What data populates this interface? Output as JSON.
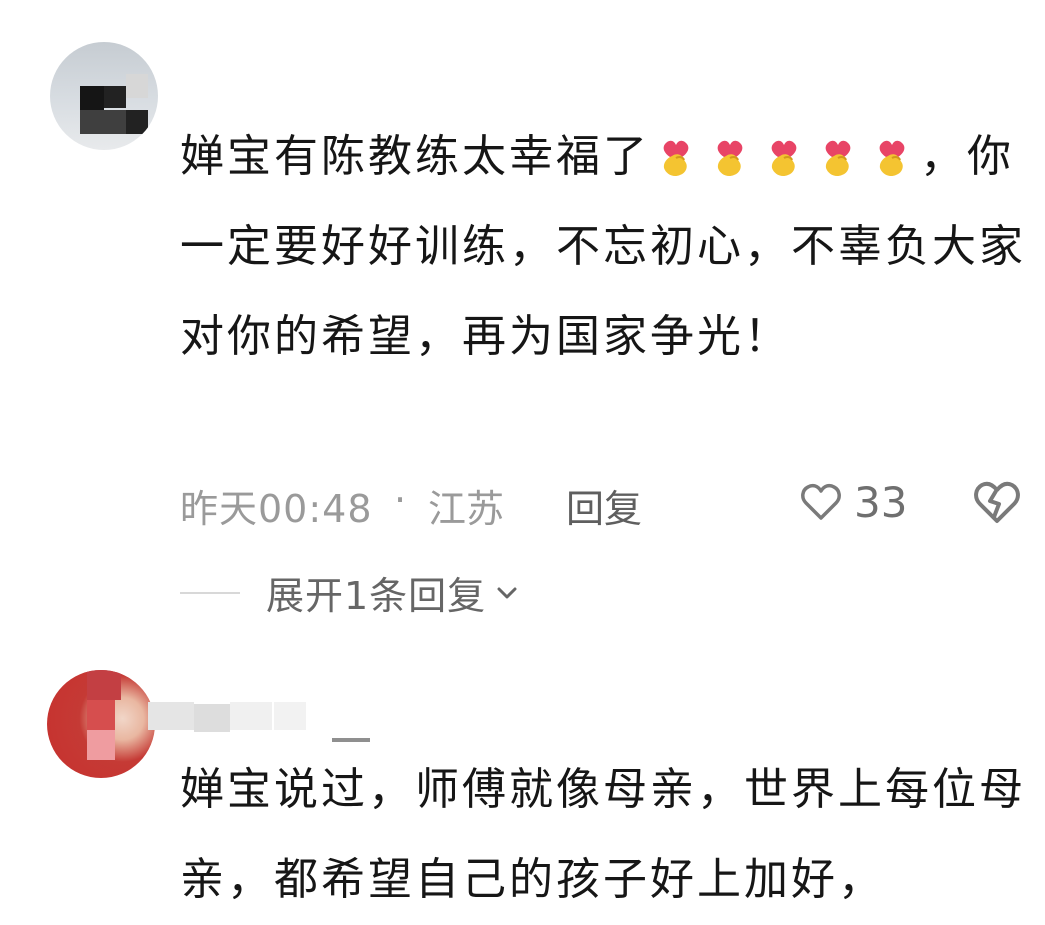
{
  "comments": [
    {
      "text_parts": [
        "婵宝有陈教练太幸福了",
        "，你一定要好好训练，不忘初心，不辜负大家对你的希望，再为国家争光！"
      ],
      "emoji": "finger-heart-emoji",
      "emoji_count": 5,
      "meta": {
        "time": "昨天00:48",
        "separator": "·",
        "location": "江苏",
        "reply_label": "回复",
        "like_count": "33"
      },
      "expand_label": "展开1条回复"
    },
    {
      "text": "婵宝说过，师傅就像母亲，世界上每位母亲，都希望自己的孩子好上加好，"
    }
  ],
  "icons": {
    "like": "heart-outline-icon",
    "dislike": "broken-heart-icon",
    "expand": "chevron-down-icon",
    "emoji": "finger-heart-emoji"
  },
  "colors": {
    "text": "#161616",
    "meta_text": "#9a9a9a",
    "reply_text": "#5f5f5f",
    "emoji_yellow": "#f4c431",
    "emoji_heart": "#e84466"
  }
}
